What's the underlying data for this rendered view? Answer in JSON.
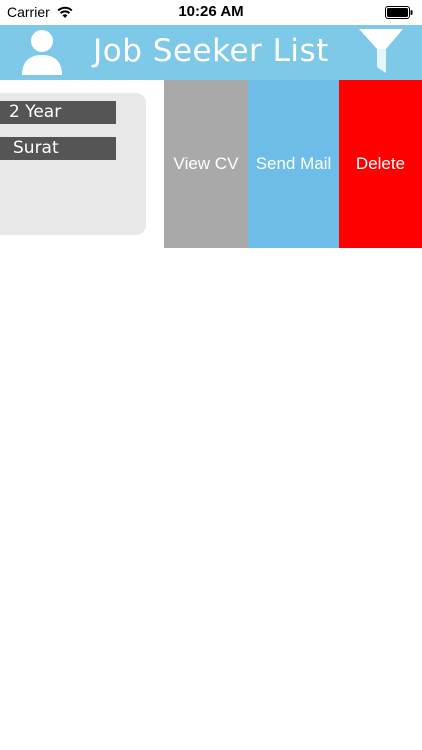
{
  "status_bar": {
    "carrier": "Carrier",
    "time": "10:26 AM"
  },
  "header": {
    "title": "Job Seeker List",
    "left_icon": "user-icon",
    "right_icon": "filter-icon"
  },
  "card": {
    "experience": "2 Year",
    "city": "Surat"
  },
  "swipe_actions": {
    "view_cv": "View CV",
    "send_mail": "Send Mail",
    "delete": "Delete"
  },
  "colors": {
    "nav_background": "#7ec8e8",
    "view_cv": "#a9a9a9",
    "send_mail": "#6dbde8",
    "delete": "#fe0000"
  }
}
